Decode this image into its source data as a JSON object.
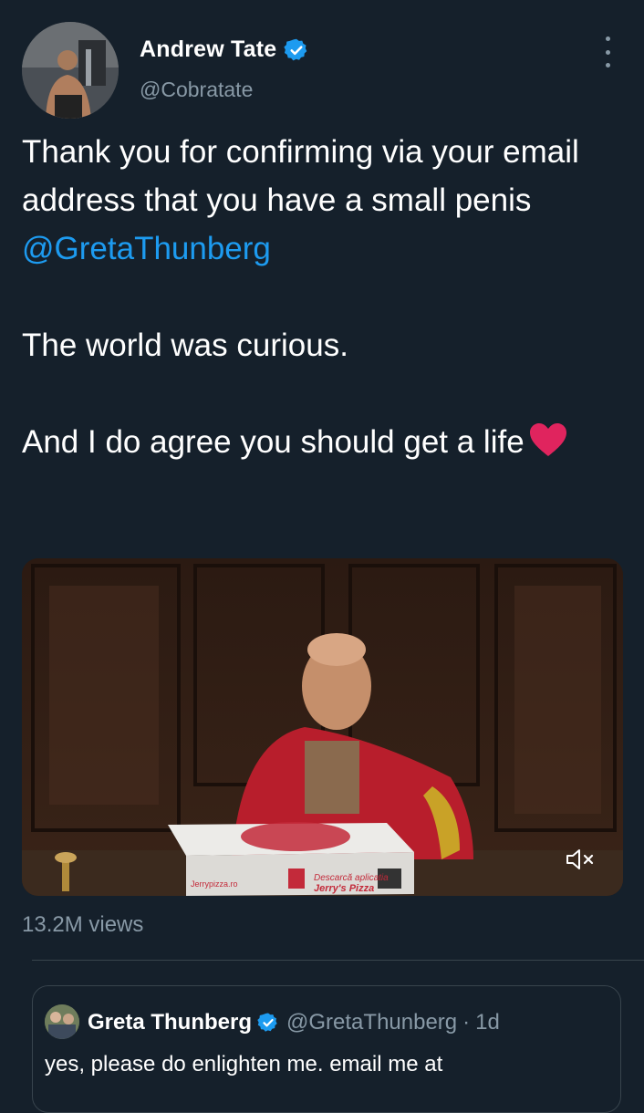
{
  "author": {
    "name": "Andrew Tate",
    "handle": "@Cobratate"
  },
  "tweet": {
    "line1_text": "Thank you for confirming via your email address that you have a small penis",
    "mention": "@GretaThunberg",
    "line2": "The world was curious.",
    "line3": "And I do agree you should get a life"
  },
  "media": {
    "pizza_box_text": "Jerry's Pizza",
    "pizza_box_small": "Descarcă aplicatia",
    "pizza_box_side": "Jerrypizza.ro"
  },
  "stats": {
    "views": "13.2M views"
  },
  "quoted_tweet": {
    "name": "Greta Thunberg",
    "handle": "@GretaThunberg",
    "separator": "·",
    "time": "1d",
    "text": "yes, please do enlighten me. email me at"
  },
  "colors": {
    "background": "#15202b",
    "link": "#1d9bf0",
    "secondary_text": "#8899a6",
    "heart": "#e0245e"
  },
  "icons": [
    "verified-badge-icon",
    "more-options-icon",
    "red-heart-emoji",
    "mute-icon"
  ]
}
